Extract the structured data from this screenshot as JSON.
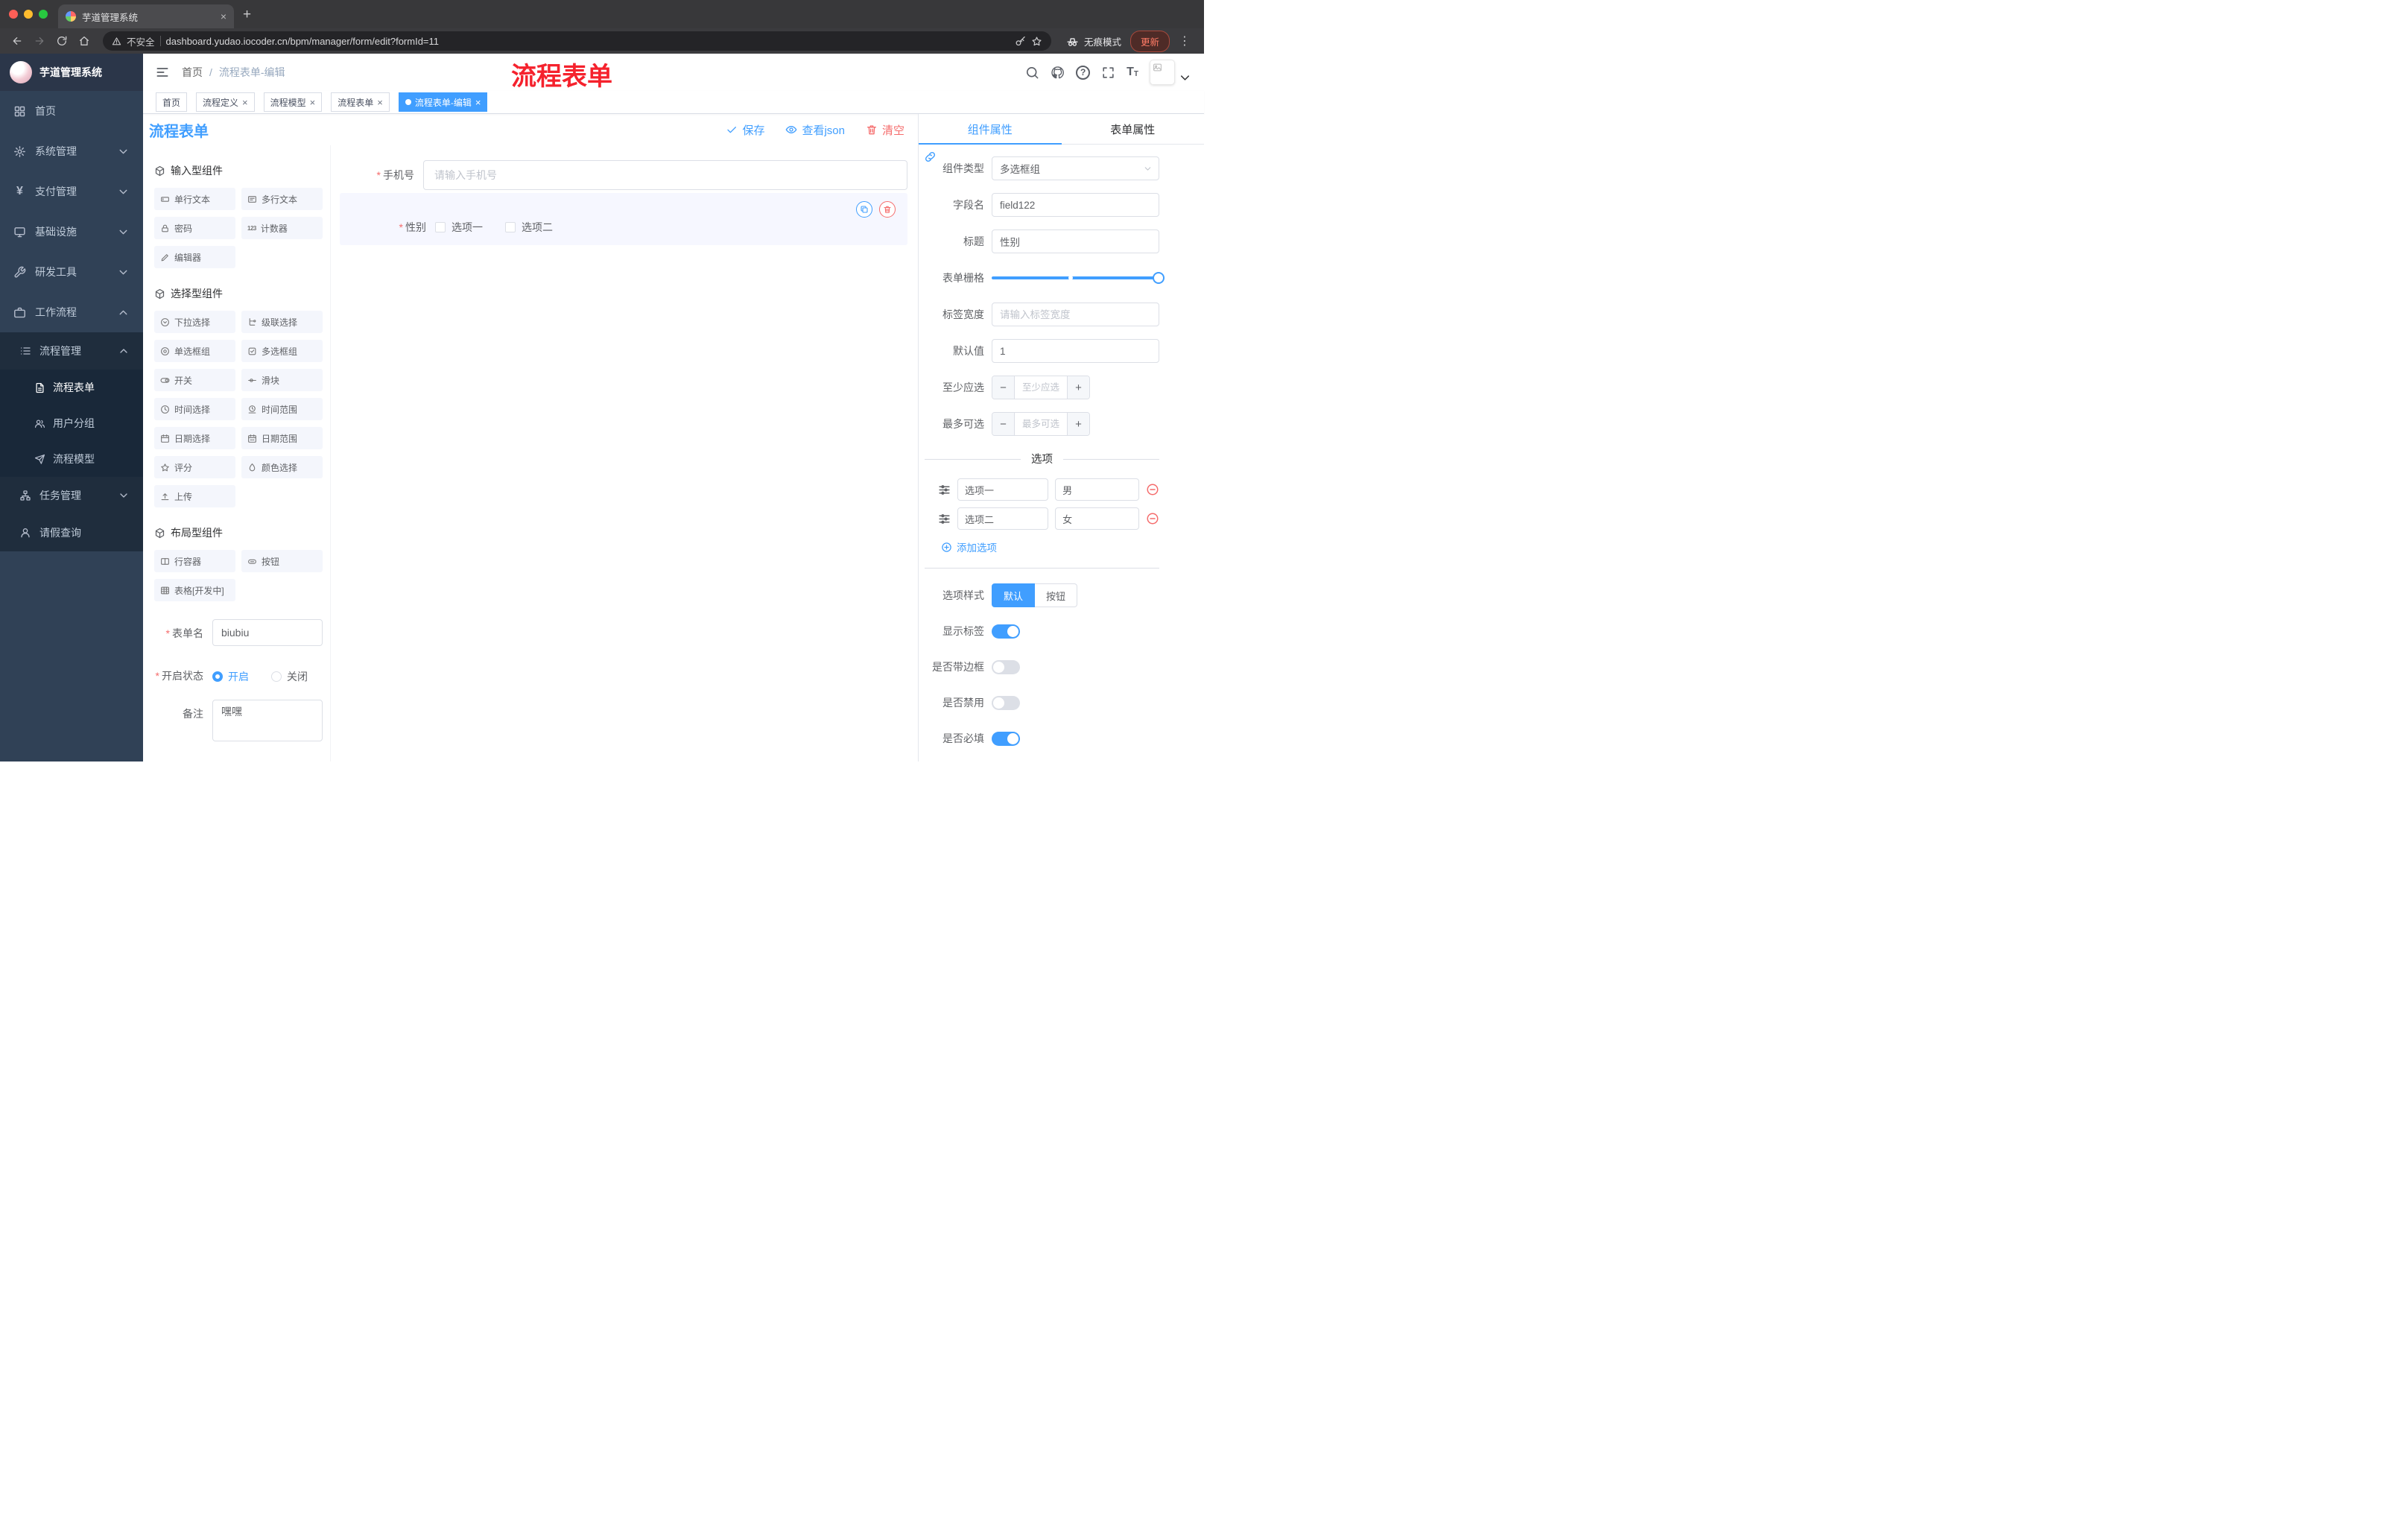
{
  "annotation": {
    "title": "流程表单"
  },
  "icons": {
    "close": "×",
    "new_tab": "+",
    "menu_dots": "⋮",
    "minus": "−",
    "plus": "+",
    "question": "?",
    "font_size_big": "T",
    "font_size_small": "T",
    "yen": "¥",
    "counter": "123",
    "breadcrumb_sep": "/",
    "required_mark": "*"
  },
  "browser": {
    "tab": {
      "title": "芋道管理系统"
    },
    "address": {
      "security": "不安全",
      "url": "dashboard.yudao.iocoder.cn/bpm/manager/form/edit?formId=11"
    },
    "incognito_label": "无痕模式",
    "update_label": "更新"
  },
  "sidebar": {
    "logo_title": "芋道管理系统",
    "items": [
      {
        "label": "首页"
      },
      {
        "label": "系统管理"
      },
      {
        "label": "支付管理"
      },
      {
        "label": "基础设施"
      },
      {
        "label": "研发工具"
      },
      {
        "label": "工作流程"
      }
    ],
    "sub": [
      {
        "label": "流程管理"
      },
      {
        "label": "流程表单"
      },
      {
        "label": "用户分组"
      },
      {
        "label": "流程模型"
      },
      {
        "label": "任务管理"
      },
      {
        "label": "请假查询"
      }
    ]
  },
  "navbar": {
    "breadcrumb": {
      "home": "首页",
      "current": "流程表单-编辑"
    }
  },
  "tags": [
    {
      "label": "首页"
    },
    {
      "label": "流程定义"
    },
    {
      "label": "流程模型"
    },
    {
      "label": "流程表单"
    },
    {
      "label": "流程表单-编辑"
    }
  ],
  "editor": {
    "title": "流程表单",
    "actions": {
      "save": "保存",
      "view_json": "查看json",
      "clear": "清空"
    },
    "palette": {
      "sections": [
        {
          "title": "输入型组件",
          "items": [
            "单行文本",
            "多行文本",
            "密码",
            "计数器",
            "编辑器"
          ]
        },
        {
          "title": "选择型组件",
          "items": [
            "下拉选择",
            "级联选择",
            "单选框组",
            "多选框组",
            "开关",
            "滑块",
            "时间选择",
            "时间范围",
            "日期选择",
            "日期范围",
            "评分",
            "颜色选择",
            "上传"
          ]
        },
        {
          "title": "布局型组件",
          "items": [
            "行容器",
            "按钮",
            "表格[开发中]"
          ]
        }
      ]
    },
    "meta": {
      "name_label": "表单名",
      "name_value": "biubiu",
      "status_label": "开启状态",
      "status_on": "开启",
      "status_off": "关闭",
      "remark_label": "备注",
      "remark_value": "嘿嘿"
    },
    "canvas": {
      "phone": {
        "label": "手机号",
        "placeholder": "请输入手机号"
      },
      "gender": {
        "label": "性别",
        "options": [
          "选项一",
          "选项二"
        ]
      }
    }
  },
  "props": {
    "tabs": {
      "component": "组件属性",
      "form": "表单属性"
    },
    "component_type": {
      "label": "组件类型",
      "value": "多选框组"
    },
    "field_name": {
      "label": "字段名",
      "value": "field122"
    },
    "title": {
      "label": "标题",
      "value": "性别"
    },
    "grid": {
      "label": "表单栅格",
      "value_percent": 100
    },
    "label_width": {
      "label": "标签宽度",
      "placeholder": "请输入标签宽度"
    },
    "default": {
      "label": "默认值",
      "value": "1"
    },
    "min": {
      "label": "至少应选",
      "placeholder": "至少应选"
    },
    "max": {
      "label": "最多可选",
      "placeholder": "最多可选"
    },
    "options": {
      "divider": "选项",
      "rows": [
        {
          "label": "选项一",
          "value": "男"
        },
        {
          "label": "选项二",
          "value": "女"
        }
      ],
      "add": "添加选项"
    },
    "style": {
      "label": "选项样式",
      "options": [
        "默认",
        "按钮"
      ],
      "selected": "默认"
    },
    "switches": [
      {
        "label": "显示标签",
        "on": true
      },
      {
        "label": "是否带边框",
        "on": false
      },
      {
        "label": "是否禁用",
        "on": false
      },
      {
        "label": "是否必填",
        "on": true
      }
    ],
    "accent_color": "#409eff",
    "danger_color": "#f56c6c"
  }
}
